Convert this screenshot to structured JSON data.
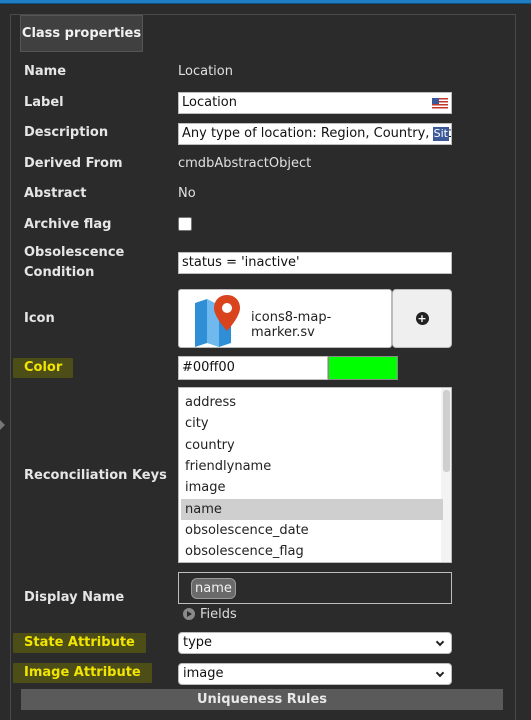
{
  "panel": {
    "legend": "Class properties"
  },
  "fields": {
    "name": {
      "label": "Name",
      "value": "Location"
    },
    "label": {
      "label": "Label",
      "value": "Location"
    },
    "description": {
      "label": "Description",
      "value": "Any type of location: Region, Country, City, Sit",
      "lang_badge": "Sit"
    },
    "derived_from": {
      "label": "Derived From",
      "value": "cmdbAbstractObject"
    },
    "abstract": {
      "label": "Abstract",
      "value": "No"
    },
    "archive_flag": {
      "label": "Archive flag",
      "checked": false
    },
    "obsolescence": {
      "label_line1": "Obsolescence",
      "label_line2": "Condition",
      "value": "status = 'inactive'"
    },
    "icon": {
      "label": "Icon",
      "filename": "icons8-map-marker.sv",
      "add_icon": "plus-circle-icon"
    },
    "color": {
      "label": "Color",
      "value": "#00ff00",
      "swatch": "#00ff00"
    },
    "reconciliation_keys": {
      "label": "Reconciliation Keys",
      "items": [
        "address",
        "city",
        "country",
        "friendlyname",
        "image",
        "name",
        "obsolescence_date",
        "obsolescence_flag"
      ],
      "selected": "name"
    },
    "display_name": {
      "label": "Display Name",
      "tag": "name",
      "fields_label": "Fields"
    },
    "state_attribute": {
      "label": "State Attribute",
      "value": "type"
    },
    "image_attribute": {
      "label": "Image Attribute",
      "value": "image"
    }
  },
  "uniqueness_rules": {
    "label": "Uniqueness Rules"
  },
  "colors": {
    "accent_highlight": "#f2e600",
    "highlight_bg": "#4d4d18",
    "topbar": "#1f7fc4"
  }
}
